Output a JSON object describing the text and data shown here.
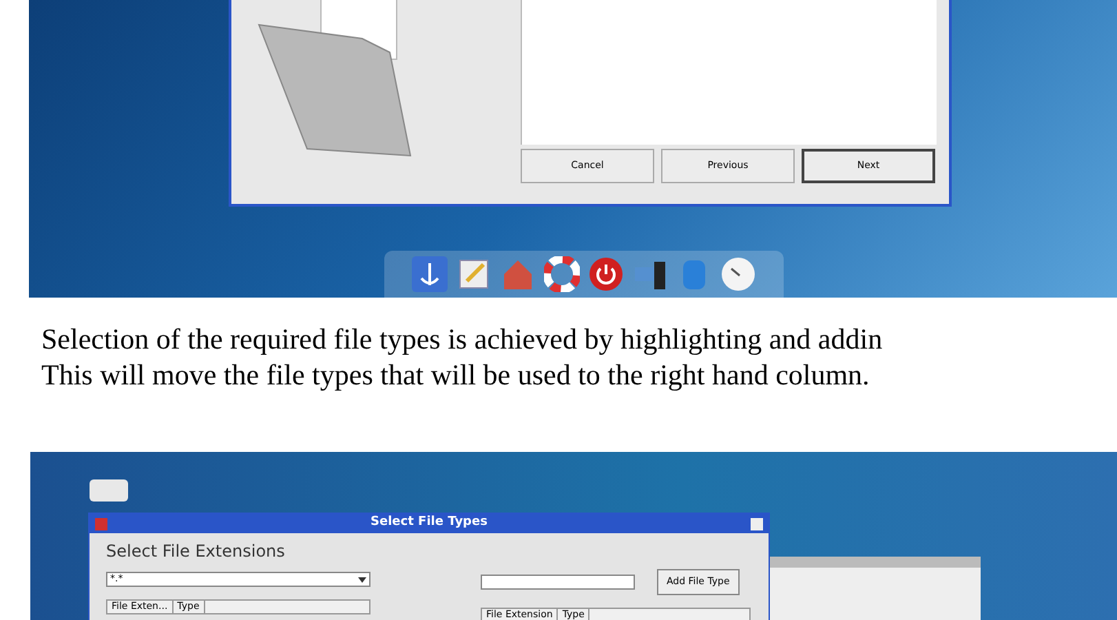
{
  "top_screenshot": {
    "buttons": [
      {
        "label": "Cancel",
        "default": false
      },
      {
        "label": "Previous",
        "default": false
      },
      {
        "label": "Next",
        "default": true
      }
    ]
  },
  "paragraph": [
    "Selection of the required file types is achieved by highlighting and addin",
    "This will move the file types that will be used to the right hand column."
  ],
  "bottom_screenshot": {
    "window_title": "Select File Types",
    "heading": "Select File Extensions",
    "filter_combo": {
      "value": "*.*"
    },
    "add_button": "Add File Type",
    "left_columns": [
      "File Exten...",
      "Type"
    ],
    "right_columns": [
      "File Extension",
      "Type"
    ]
  }
}
